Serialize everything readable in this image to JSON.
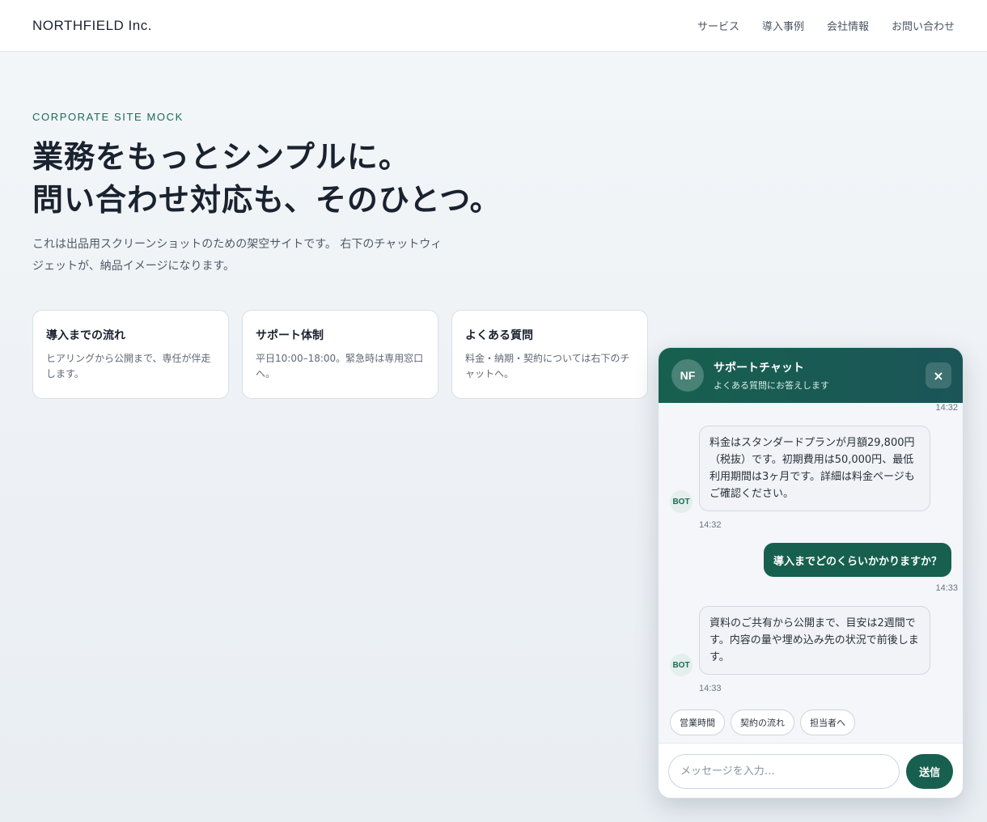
{
  "header": {
    "logo": "NORTHFIELD Inc.",
    "nav": [
      "サービス",
      "導入事例",
      "会社情報",
      "お問い合わせ"
    ]
  },
  "hero": {
    "eyebrow": "CORPORATE SITE MOCK",
    "title_lines": [
      "業務をもっとシンプルに。",
      "問い合わせ対応も、そのひとつ。"
    ],
    "description": "これは出品用スクリーンショットのための架空サイトです。 右下のチャットウィジェットが、納品イメージになります。"
  },
  "cards": [
    {
      "title": "導入までの流れ",
      "text": "ヒアリングから公開まで、専任が伴走します。"
    },
    {
      "title": "サポート体制",
      "text": "平日10:00–18:00。緊急時は専用窓口へ。"
    },
    {
      "title": "よくある質問",
      "text": "料金・納期・契約については右下のチャットへ。"
    }
  ],
  "chat": {
    "avatar": "NF",
    "title": "サポートチャット",
    "subtitle": "よくある質問にお答えします",
    "close_label": "×",
    "bot_label": "BOT",
    "messages": [
      {
        "from": "user",
        "time": "14:32"
      },
      {
        "from": "bot",
        "text": "料金はスタンダードプランが月額29,800円（税抜）です。初期費用は50,000円、最低利用期間は3ヶ月です。詳細は料金ページもご確認ください。",
        "time": "14:32"
      },
      {
        "from": "user",
        "text": "導入までどのくらいかかりますか？",
        "time": "14:33"
      },
      {
        "from": "bot",
        "text": "資料のご共有から公開まで、目安は2週間です。内容の量や埋め込み先の状況で前後します。",
        "time": "14:33"
      }
    ],
    "quick_replies": [
      "営業時間",
      "契約の流れ",
      "担当者へ"
    ],
    "input_placeholder": "メッセージを入力…",
    "send_label": "送信"
  },
  "colors": {
    "accent": "#17604f",
    "eyebrow": "#1a6b57"
  }
}
